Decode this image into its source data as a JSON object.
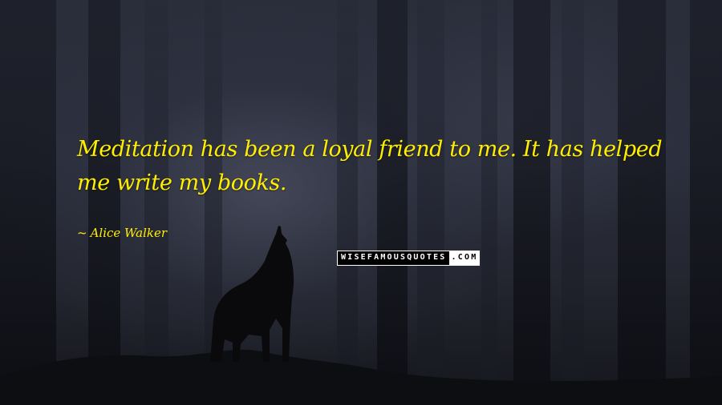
{
  "quote": {
    "text": "Meditation has been a loyal friend to me. It has helped me write my books.",
    "author": "Alice Walker",
    "author_prefix": "~",
    "color": "#ffee00"
  },
  "watermark": {
    "site": "WISEFAMOUSQUOTES",
    "tld": ".COM"
  },
  "background": {
    "description_color": "#2a2d3a"
  }
}
